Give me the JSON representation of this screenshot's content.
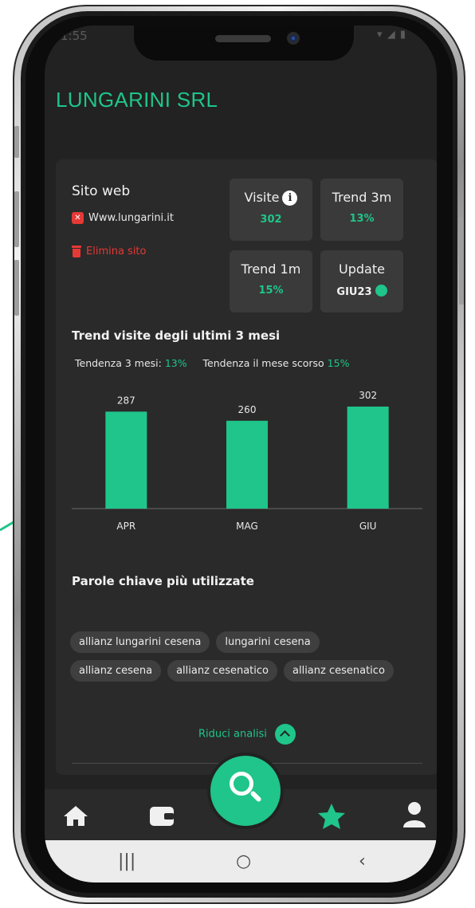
{
  "status": {
    "time": "1:55",
    "signal": "▾ ◢ ▮"
  },
  "company": "LUNGARINI SRL",
  "site": {
    "title": "Sito web",
    "url": "Www.lungarini.it",
    "url_icon": "close-x-icon",
    "delete_label": "Elimina sito",
    "delete_icon": "trash-icon"
  },
  "stats": [
    {
      "label": "Visite",
      "value": "302",
      "icon": "info-icon"
    },
    {
      "label": "Trend 3m",
      "value": "13%"
    },
    {
      "label": "Trend 1m",
      "value": "15%"
    },
    {
      "label": "Update",
      "value": "GIU23",
      "icon": "green-status-dot"
    }
  ],
  "trend": {
    "title": "Trend visite degli ultimi 3 mesi",
    "three_label": "Tendenza 3 mesi:",
    "three_value": "13%",
    "last_label": "Tendenza il mese scorso",
    "last_value": "15%"
  },
  "chart_data": {
    "type": "bar",
    "categories": [
      "APR",
      "MAG",
      "GIU"
    ],
    "values": [
      287,
      260,
      302
    ],
    "color": "#1fc58a",
    "title": "",
    "xlabel": "",
    "ylabel": ""
  },
  "keywords": {
    "title": "Parole chiave più utilizzate",
    "rows": [
      [
        "allianz lungarini cesena",
        "lungarini cesena"
      ],
      [
        "allianz cesena",
        "allianz cesenatico",
        "allianz cesenatico"
      ]
    ]
  },
  "reduce_label": "Riduci analisi",
  "nav": {
    "items": [
      "home-icon",
      "wallet-icon",
      "search-icon",
      "star-icon",
      "user-icon"
    ],
    "active": "star-icon"
  },
  "system_nav": {
    "recents": "|||",
    "home": "○",
    "back": "‹"
  },
  "colors": {
    "accent": "#1fc58a",
    "background": "#222222",
    "card": "#2a2a2a",
    "danger": "#e53935"
  }
}
